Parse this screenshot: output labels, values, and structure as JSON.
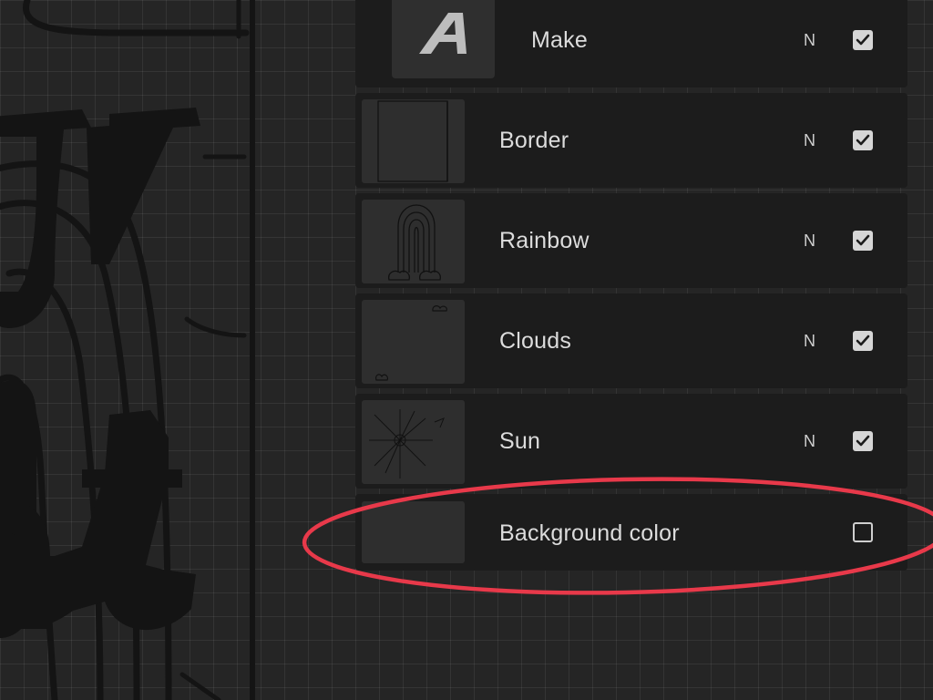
{
  "canvas": {
    "background_color": "#252525",
    "art_color": "#141414"
  },
  "layers": [
    {
      "name": "Make",
      "blend_mode": "N",
      "visible": true,
      "thumbnail": "text-layer-icon"
    },
    {
      "name": "Border",
      "blend_mode": "N",
      "visible": true,
      "thumbnail": "border-thumbnail"
    },
    {
      "name": "Rainbow",
      "blend_mode": "N",
      "visible": true,
      "thumbnail": "rainbow-thumbnail"
    },
    {
      "name": "Clouds",
      "blend_mode": "N",
      "visible": true,
      "thumbnail": "clouds-thumbnail"
    },
    {
      "name": "Sun",
      "blend_mode": "N",
      "visible": true,
      "thumbnail": "sun-thumbnail"
    },
    {
      "name": "Background color",
      "blend_mode": "",
      "visible": false,
      "thumbnail": "background-swatch"
    }
  ],
  "annotation": {
    "shape": "ellipse",
    "color": "#e8394a",
    "target": "Background color"
  }
}
